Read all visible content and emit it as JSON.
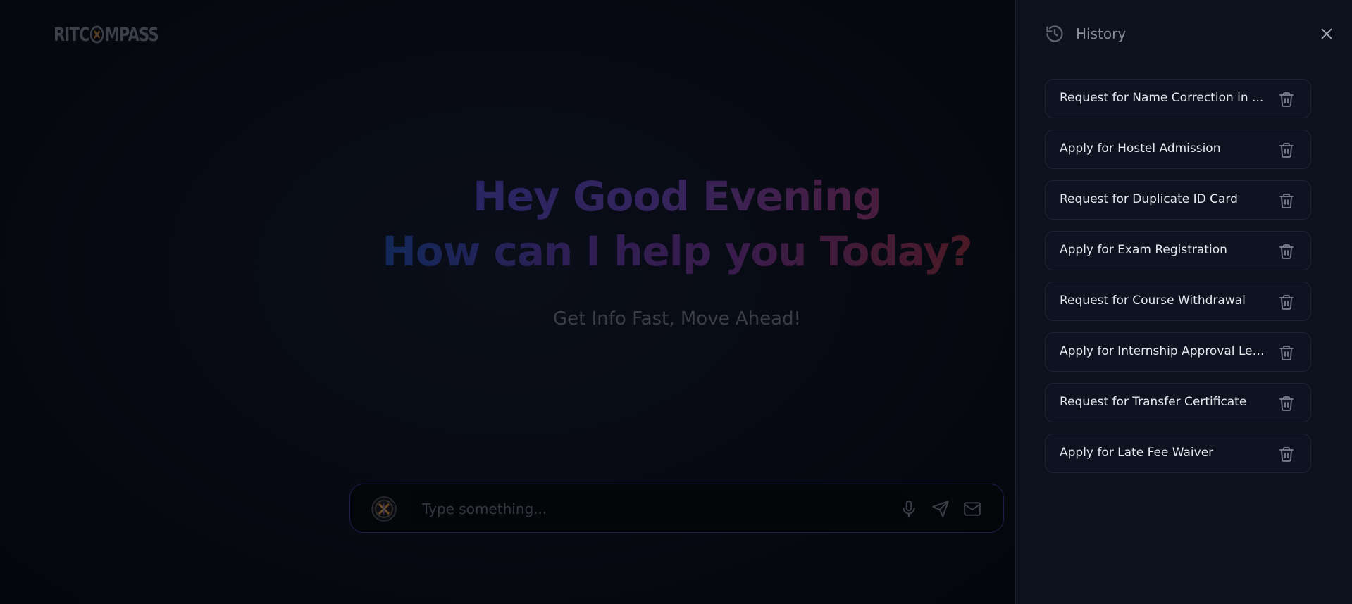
{
  "app": {
    "logo_text_left": "RITC",
    "logo_text_right": "MPASS"
  },
  "hero": {
    "line1": "Hey Good Evening",
    "line2": "How can I help you Today?",
    "subtitle": "Get Info Fast, Move Ahead!"
  },
  "input": {
    "placeholder": "Type something..."
  },
  "icons": {
    "avatar": "compass-logo-icon",
    "mic": "microphone-icon",
    "send": "send-icon",
    "mail": "mail-icon",
    "history": "history-icon",
    "close": "close-icon",
    "delete": "trash-icon"
  },
  "history": {
    "title": "History",
    "items": [
      {
        "label": "Request for Name Correction in ..."
      },
      {
        "label": "Apply for Hostel Admission"
      },
      {
        "label": "Request for Duplicate ID Card"
      },
      {
        "label": "Apply for Exam Registration"
      },
      {
        "label": "Request for Course Withdrawal"
      },
      {
        "label": "Apply for Internship Approval Let..."
      },
      {
        "label": "Request for Transfer Certificate"
      },
      {
        "label": "Apply for Late Fee Waiver"
      }
    ]
  },
  "colors": {
    "panel_bg": "#0c111d",
    "item_border": "#1c2231",
    "input_border": "#1c1f4a"
  }
}
